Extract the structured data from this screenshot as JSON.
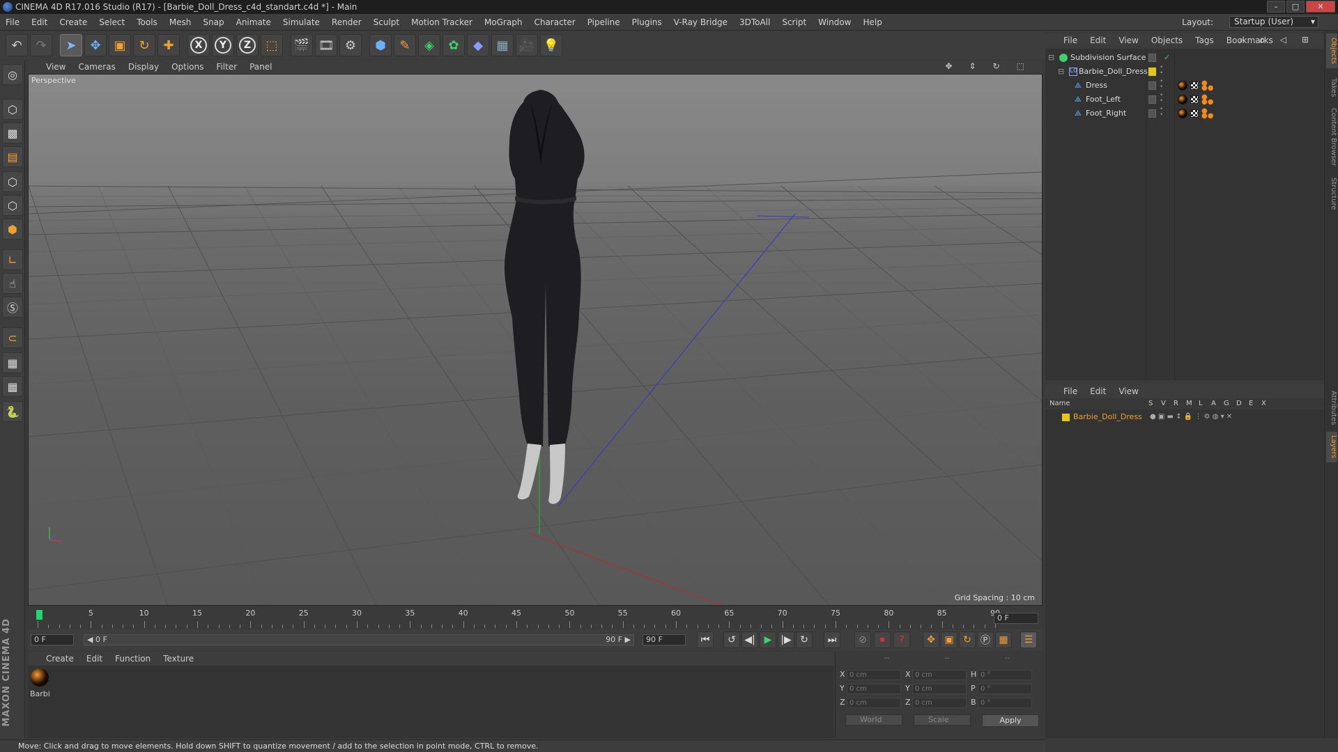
{
  "window": {
    "title": "CINEMA 4D R17.016 Studio (R17) - [Barbie_Doll_Dress_c4d_standart.c4d *] - Main",
    "buttons": [
      "–",
      "□",
      "✕"
    ]
  },
  "menubar": {
    "items": [
      "File",
      "Edit",
      "Create",
      "Select",
      "Tools",
      "Mesh",
      "Snap",
      "Animate",
      "Simulate",
      "Render",
      "Sculpt",
      "Motion Tracker",
      "MoGraph",
      "Character",
      "Pipeline",
      "Plugins",
      "V-Ray Bridge",
      "3DToAll",
      "Script",
      "Window",
      "Help"
    ],
    "layout_label": "Layout:",
    "layout_value": "Startup (User)"
  },
  "toolbar": {
    "axis_x": "X",
    "axis_y": "Y",
    "axis_z": "Z"
  },
  "viewport": {
    "menu": [
      "View",
      "Cameras",
      "Display",
      "Options",
      "Filter",
      "Panel"
    ],
    "label": "Perspective",
    "grid_spacing": "Grid Spacing : 10 cm"
  },
  "timeline": {
    "ticks": [
      "0",
      "5",
      "10",
      "15",
      "20",
      "25",
      "30",
      "35",
      "40",
      "45",
      "50",
      "55",
      "60",
      "65",
      "70",
      "75",
      "80",
      "85",
      "90"
    ],
    "current_frame": "0 F",
    "start_field": "0 F",
    "range_start": "◀ 0 F",
    "range_end": "90 F ▶",
    "end_field": "90 F"
  },
  "materials": {
    "menu": [
      "Create",
      "Edit",
      "Function",
      "Texture"
    ],
    "items": [
      {
        "name": "Barbi"
      }
    ]
  },
  "coordinates": {
    "headers": [
      "--",
      "--",
      "--"
    ],
    "rows": [
      {
        "a": "X",
        "av": "0 cm",
        "b": "X",
        "bv": "0 cm",
        "c": "H",
        "cv": "0 °"
      },
      {
        "a": "Y",
        "av": "0 cm",
        "b": "Y",
        "bv": "0 cm",
        "c": "P",
        "cv": "0 °"
      },
      {
        "a": "Z",
        "av": "0 cm",
        "b": "Z",
        "bv": "0 cm",
        "c": "B",
        "cv": "0 °"
      }
    ],
    "mode_world": "World",
    "mode_scale": "Scale",
    "apply": "Apply"
  },
  "status": "Move: Click and drag to move elements. Hold down SHIFT to quantize movement / add to the selection in point mode, CTRL to remove.",
  "object_manager": {
    "menu": [
      "File",
      "Edit",
      "View",
      "Objects",
      "Tags",
      "Bookmarks"
    ],
    "objects": [
      {
        "name": "Subdivision Surface"
      },
      {
        "name": "Barbie_Doll_Dress"
      },
      {
        "name": "Dress"
      },
      {
        "name": "Foot_Left"
      },
      {
        "name": "Foot_Right"
      }
    ]
  },
  "layer_manager": {
    "menu": [
      "File",
      "Edit",
      "View"
    ],
    "columns": [
      "Name",
      "S",
      "V",
      "R",
      "M",
      "L",
      "A",
      "G",
      "D",
      "E",
      "X"
    ],
    "layers": [
      {
        "name": "Barbie_Doll_Dress",
        "color": "#e6c619"
      }
    ]
  },
  "side_tabs": [
    "Objects",
    "Takes",
    "Content Browser",
    "Structure",
    "Attributes",
    "Layers"
  ],
  "branding": "MAXON CINEMA 4D",
  "colors": {
    "accent": "#f0a030",
    "layer_name": "#f0a030",
    "timeline_marker": "#1fd66a"
  }
}
